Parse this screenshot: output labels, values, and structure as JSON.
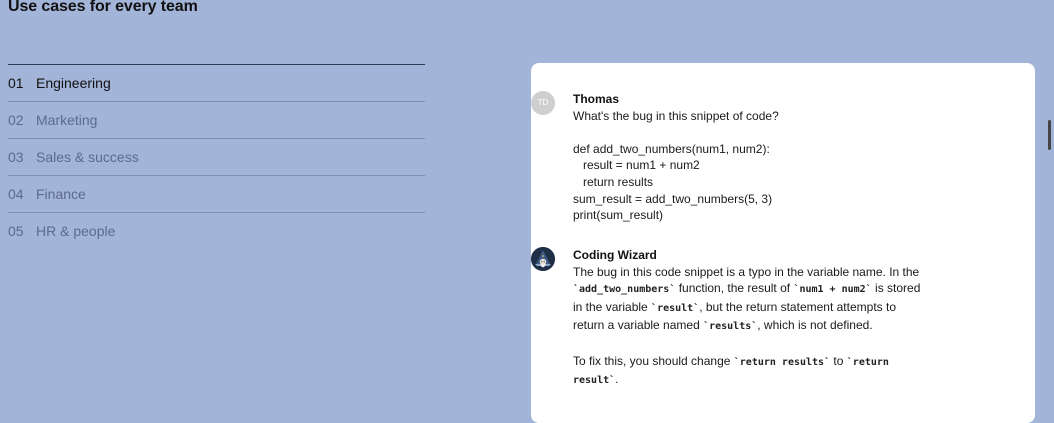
{
  "section": {
    "title": "Use cases for every team"
  },
  "tabs": [
    {
      "num": "01",
      "label": "Engineering"
    },
    {
      "num": "02",
      "label": "Marketing"
    },
    {
      "num": "03",
      "label": "Sales & success"
    },
    {
      "num": "04",
      "label": "Finance"
    },
    {
      "num": "05",
      "label": "HR & people"
    }
  ],
  "chat": {
    "user": {
      "initials": "TD",
      "name": "Thomas",
      "question": "What's the bug in this snippet of code?",
      "code": "def add_two_numbers(num1, num2):\n   result = num1 + num2\n   return results\nsum_result = add_two_numbers(5, 3)\nprint(sum_result)"
    },
    "assistant": {
      "name": "Coding Wizard",
      "icon": "wizard-avatar-icon",
      "p1_a": "The bug in this code snippet is a typo in the variable name. In the ",
      "p1_code1": "`add_two_numbers`",
      "p1_b": " function, the result of ",
      "p1_code2": "`num1 + num2`",
      "p1_c": " is stored in the variable ",
      "p1_code3": "`result`",
      "p1_d": ", but the return statement attempts to return a variable named ",
      "p1_code4": "`results`",
      "p1_e": ", which is not defined.",
      "p2_a": "To fix this, you should change ",
      "p2_code1": "`return results`",
      "p2_b": " to ",
      "p2_code2": "`return result`",
      "p2_c": "."
    }
  },
  "colors": {
    "background": "#a2b4d8",
    "card": "#ffffff",
    "active_text": "#111111",
    "inactive_text": "#5c6b8c"
  }
}
